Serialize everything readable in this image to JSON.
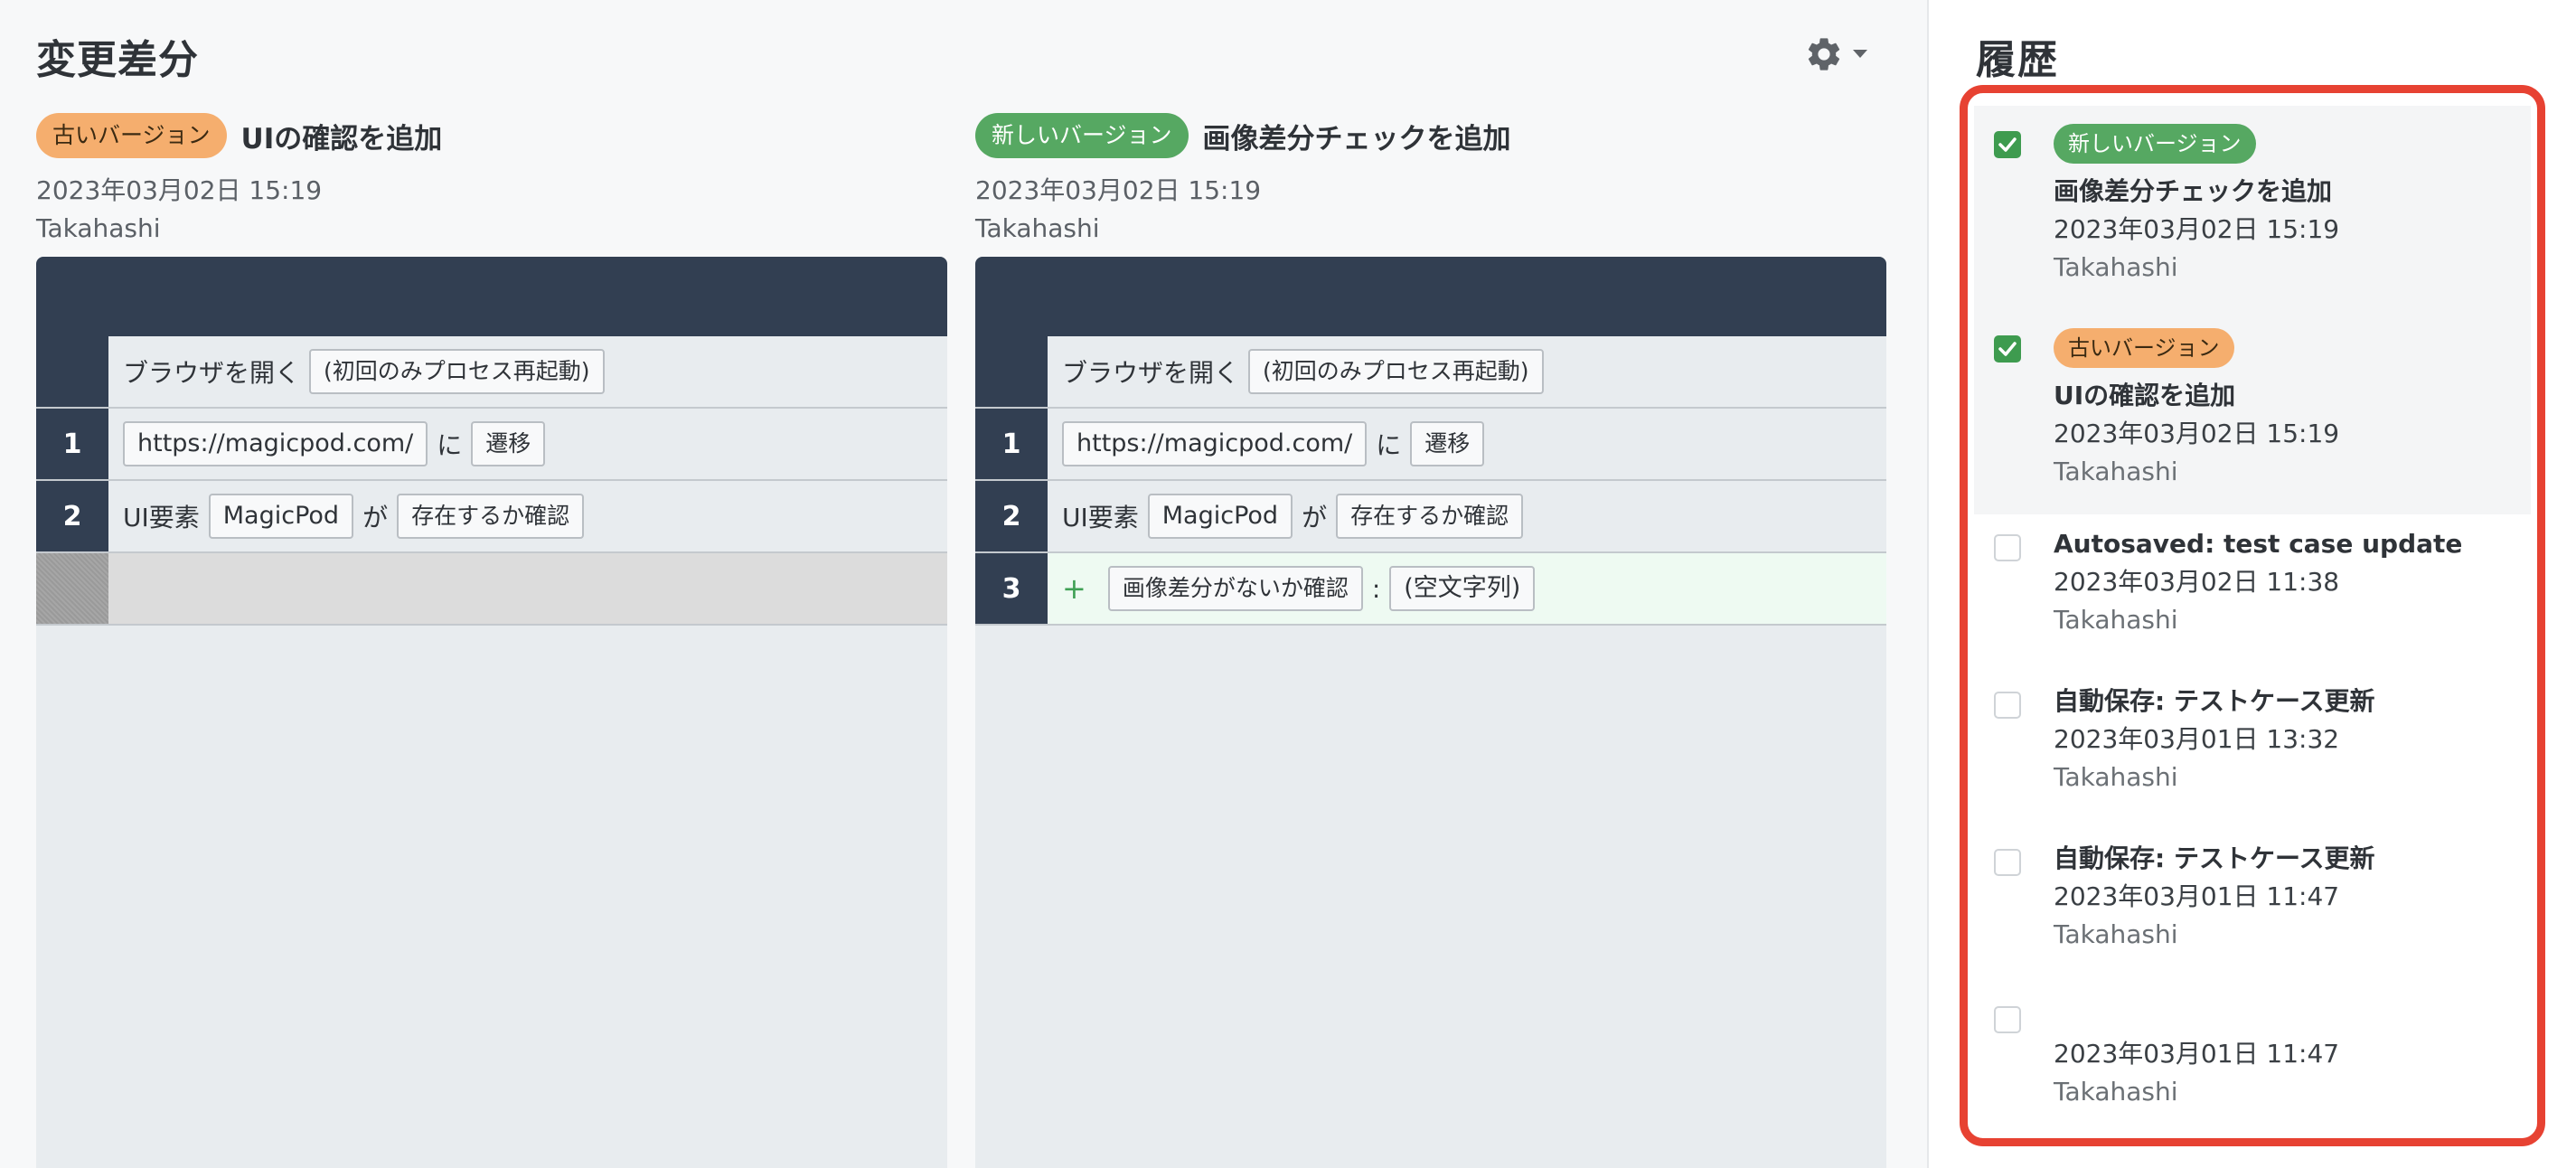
{
  "diff": {
    "title": "変更差分",
    "settings_icon": "gear-icon",
    "old": {
      "badge": "古いバージョン",
      "title": "UIの確認を追加",
      "date": "2023年03月02日 15:19",
      "author": "Takahashi",
      "header_row": {
        "text": "ブラウザを開く",
        "chip": "(初回のみプロセス再起動)"
      },
      "steps": [
        {
          "num": "1",
          "url": "https://magicpod.com/",
          "particle": "に",
          "action": "遷移"
        },
        {
          "num": "2",
          "prefix": "UI要素",
          "element": "MagicPod",
          "particle": "が",
          "action": "存在するか確認"
        }
      ]
    },
    "new": {
      "badge": "新しいバージョン",
      "title": "画像差分チェックを追加",
      "date": "2023年03月02日 15:19",
      "author": "Takahashi",
      "header_row": {
        "text": "ブラウザを開く",
        "chip": "(初回のみプロセス再起動)"
      },
      "steps": [
        {
          "num": "1",
          "url": "https://magicpod.com/",
          "particle": "に",
          "action": "遷移"
        },
        {
          "num": "2",
          "prefix": "UI要素",
          "element": "MagicPod",
          "particle": "が",
          "action": "存在するか確認"
        },
        {
          "num": "3",
          "plus": "+",
          "action": "画像差分がないか確認",
          "separator": ":",
          "value": "(空文字列)"
        }
      ]
    }
  },
  "history": {
    "title": "履歴",
    "items": [
      {
        "checked": true,
        "badge": "新しいバージョン",
        "title": "画像差分チェックを追加",
        "date": "2023年03月02日 15:19",
        "author": "Takahashi"
      },
      {
        "checked": true,
        "badge": "古いバージョン",
        "title": "UIの確認を追加",
        "date": "2023年03月02日 15:19",
        "author": "Takahashi"
      },
      {
        "checked": false,
        "title": "Autosaved: test case update",
        "date": "2023年03月02日 11:38",
        "author": "Takahashi"
      },
      {
        "checked": false,
        "title": "自動保存: テストケース更新",
        "date": "2023年03月01日 13:32",
        "author": "Takahashi"
      },
      {
        "checked": false,
        "title": "自動保存: テストケース更新",
        "date": "2023年03月01日 11:47",
        "author": "Takahashi"
      },
      {
        "checked": false,
        "title": "",
        "date": "2023年03月01日 11:47",
        "author": "Takahashi"
      }
    ]
  },
  "colors": {
    "badge_old": "#f5ae6e",
    "badge_new": "#56a862",
    "table_dark": "#323f52",
    "highlight_border": "#e74232",
    "checkbox_on": "#3e9b4f"
  }
}
